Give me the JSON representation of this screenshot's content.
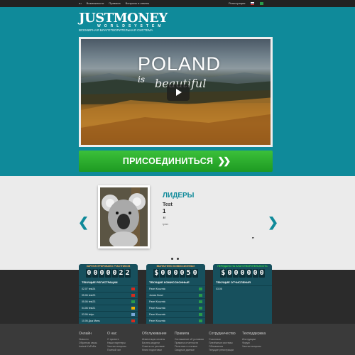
{
  "topbar": {
    "lang": "ru",
    "nav": [
      "Возможности",
      "Правила",
      "Вопросы и ответы"
    ],
    "register": "Регистрация"
  },
  "logo": {
    "name": "JUSTMONEY",
    "world": "WORLDSYSTEM",
    "tagline": "ВСЕМИРНАЯ БЛАГОТВОРИТЕЛЬНАЯ СИСТЕМА"
  },
  "video": {
    "title": "POLAND",
    "subtitle_1": "is",
    "subtitle_2": "beautiful"
  },
  "join_button": "ПРИСОЕДИНИТЬСЯ",
  "leaders": {
    "title": "ЛИДЕРЫ",
    "name": "Test",
    "rank": "1",
    "quote_open": "“",
    "small": "tyrrer",
    "quote_close": "”"
  },
  "panels": [
    {
      "header": "ЗАРЕГИСТРИРОВАНО УЧАСТНИКОВ",
      "counter": [
        "0",
        "0",
        "0",
        "0",
        "0",
        "2",
        "2"
      ],
      "sub": "ТЕКУЩИЕ РЕГИСТРАЦИИ",
      "rows": [
        {
          "text": "02.07 test24",
          "flag": "#d52b1e"
        },
        {
          "text": "05.06 test23",
          "flag": "#d52b1e"
        },
        {
          "text": "05.06 test23",
          "flag": "#2a9a4a"
        },
        {
          "text": "04.06 test21",
          "flag": "#f0b400"
        },
        {
          "text": "03.06 tetyo",
          "flag": "#7aa7d8"
        },
        {
          "text": "10.06 Дык Минь",
          "flag": "#d52b1e"
        }
      ]
    },
    {
      "header": "ВЫПЛАЧЕНО КОМИССИОННЫХ",
      "counter": [
        "$",
        "0",
        "0",
        "0",
        "0",
        "5",
        "0"
      ],
      "sub": "ТЕКУЩИЕ КОМИССИОННЫЕ",
      "rows": [
        {
          "text": "Pavel Kouzmic",
          "flag": "#2a9a4a"
        },
        {
          "text": "James Bond",
          "flag": "#2a9a4a"
        },
        {
          "text": "Pavel Kouzmic",
          "flag": "#2a9a4a"
        },
        {
          "text": "Pavel Kouzmic",
          "flag": "#2a9a4a"
        },
        {
          "text": "Pavel Kouzmic",
          "flag": "#2a9a4a"
        },
        {
          "text": "Pavel Kouzmic",
          "flag": "#2a9a4a"
        }
      ]
    },
    {
      "header": "ПЕРЕДАНО НА БЛАГОТВОРИТЕЛЬНОСТЬ",
      "counter": [
        "$",
        "0",
        "0",
        "0",
        "0",
        "0",
        "0"
      ],
      "sub": "ТЕКУЩИЕ ОТЧИСЛЕНИЯ",
      "rows": [
        {
          "text": "03.06",
          "flag": ""
        }
      ]
    }
  ],
  "footer": {
    "columns": [
      {
        "title": "Онлайн",
        "items": [
          "Новости",
          "Обратная связь",
          "Instant KaPuBa"
        ]
      },
      {
        "title": "О нас",
        "items": [
          "О проекте",
          "Наши партнеры",
          "Частые вопросы",
          "Полный чат"
        ]
      },
      {
        "title": "Обслуживание",
        "items": [
          "Инвестиции оплаты",
          "Бизнес-модели",
          "Советы по рекламе",
          "Книги подготовки"
        ]
      },
      {
        "title": "Правила",
        "items": [
          "Соглашение об условиях",
          "Правила отчетности",
          "Политика и отклики",
          "Сводные данные"
        ]
      },
      {
        "title": "Сотрудничество",
        "items": [
          "Участники",
          "Платёжные системы",
          "Обновления",
          "Текущие регистрации"
        ]
      },
      {
        "title": "Техподдержка",
        "items": [
          "Инструкции",
          "Форум",
          "Частые вопросы"
        ]
      }
    ]
  }
}
